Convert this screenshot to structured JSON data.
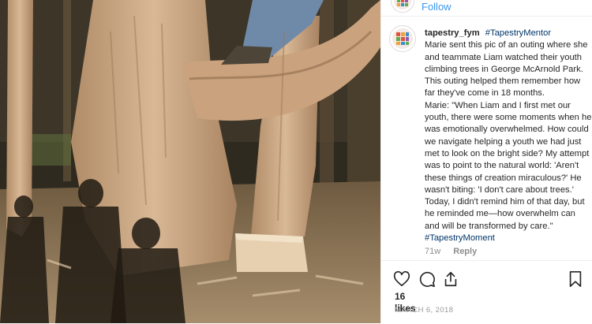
{
  "post": {
    "follow_label": "Follow",
    "username": "tapestry_fym",
    "hashtag_top": "#TapestryMentor",
    "caption_p1": "Marie sent this pic of an outing where she and teammate Liam watched their youth climbing trees in George McArnold Park. This outing helped them remember how far they've come in 18 months.",
    "caption_p2": "Marie: \"When Liam and I first met our youth, there were some moments when he was emotionally overwhelmed. How could we navigate helping a youth we had just met to look on the bright side? My attempt was to point to the natural world: 'Aren't these things of creation miraculous?' He wasn't biting: 'I don't care about trees.' Today, I didn't remind him of that day, but he reminded me—how overwhelm can and will be transformed by care.\"",
    "hashtag_bottom": "#TapestryMoment",
    "age": "71w",
    "reply_label": "Reply",
    "likes_count": "16",
    "likes_label": "likes",
    "date": "MARCH 6, 2018"
  },
  "icons": {
    "like": "heart-icon",
    "comment": "comment-bubble-icon",
    "share": "share-icon",
    "save": "bookmark-icon"
  },
  "colors": {
    "link_blue": "#3897f0",
    "hashtag_navy": "#003569",
    "muted_gray": "#8e8e8e"
  }
}
